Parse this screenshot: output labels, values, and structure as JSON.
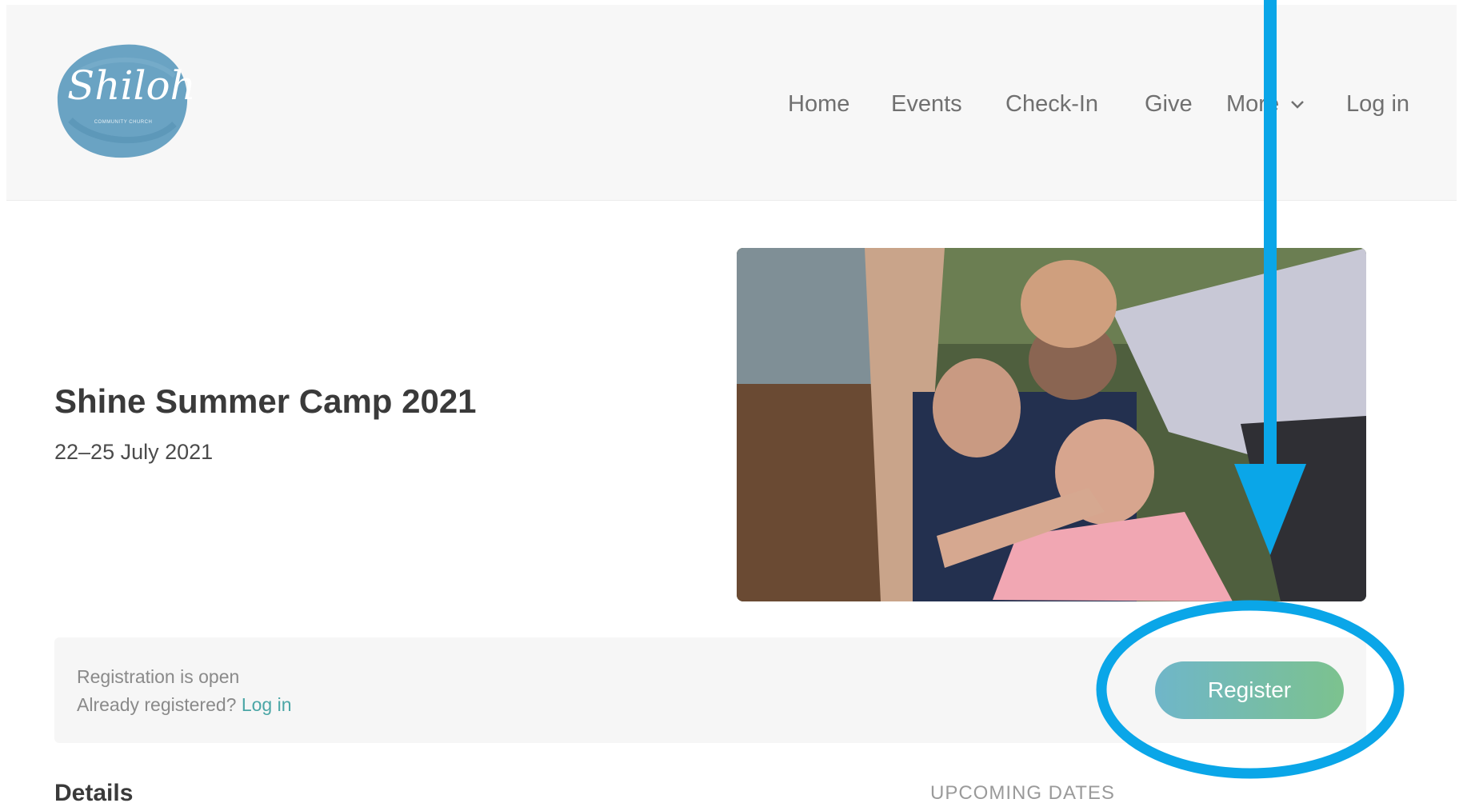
{
  "header": {
    "logo": {
      "text": "Shiloh",
      "subtitle": "COMMUNITY CHURCH",
      "color": "#5d9bbe"
    },
    "nav": [
      {
        "label": "Home"
      },
      {
        "label": "Events"
      },
      {
        "label": "Check-In"
      },
      {
        "label": "Give"
      },
      {
        "label": "More"
      },
      {
        "label": "Log in"
      }
    ]
  },
  "event": {
    "title": "Shine Summer Camp 2021",
    "date": "22–25 July 2021"
  },
  "registration": {
    "status": "Registration is open",
    "already_registered": "Already registered?",
    "login_link": "Log in",
    "register_button": "Register"
  },
  "sections": {
    "details": "Details",
    "upcoming_dates": "UPCOMING DATES"
  },
  "colors": {
    "accent_link": "#4aa6a6",
    "button_gradient_start": "#6fb6c9",
    "button_gradient_end": "#7cc28e",
    "annotation": "#0aa6e8"
  },
  "icons": [
    "chevron-down-icon",
    "annotation-arrow",
    "annotation-circle"
  ]
}
